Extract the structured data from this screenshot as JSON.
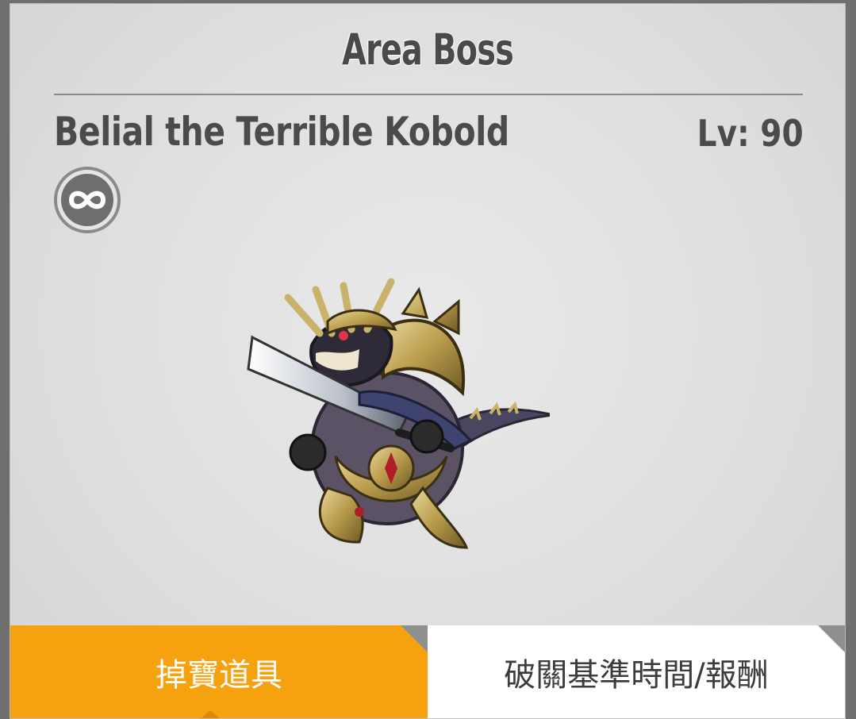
{
  "header": {
    "title": "Area Boss"
  },
  "boss": {
    "name": "Belial the Terrible Kobold",
    "level_label": "Lv: 90",
    "badge_icon": "infinity-loop-icon"
  },
  "tabs": [
    {
      "label": "掉寶道具",
      "active": true
    },
    {
      "label": "破關基準時間/報酬",
      "active": false
    }
  ],
  "colors": {
    "active_tab": "#f6a10e",
    "inactive_tab": "#ffffff",
    "panel": "#e4e4e4",
    "title_text": "#4a4a4a"
  }
}
